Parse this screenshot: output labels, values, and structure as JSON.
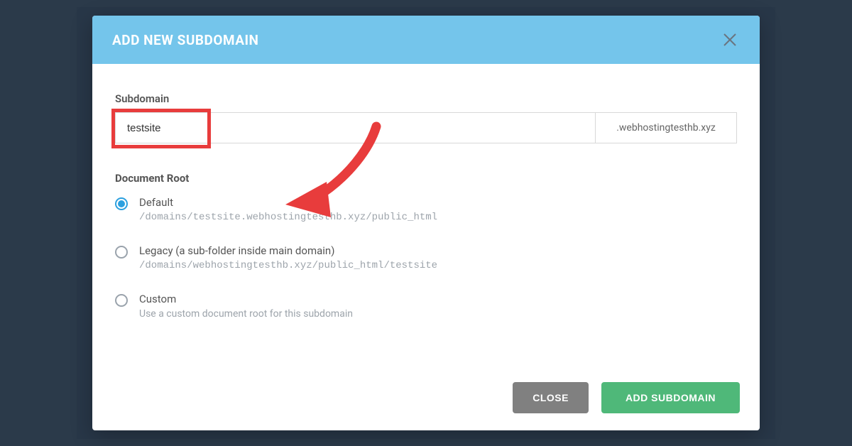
{
  "modal": {
    "title": "ADD NEW SUBDOMAIN",
    "subdomain_label": "Subdomain",
    "subdomain_value": "testsite",
    "domain_suffix": ".webhostingtesthb.xyz",
    "docroot_label": "Document Root",
    "options": {
      "default": {
        "title": "Default",
        "path": "/domains/testsite.webhostingtesthb.xyz/public_html"
      },
      "legacy": {
        "title": "Legacy (a sub-folder inside main domain)",
        "path": "/domains/webhostingtesthb.xyz/public_html/testsite"
      },
      "custom": {
        "title": "Custom",
        "desc": "Use a custom document root for this subdomain"
      }
    },
    "buttons": {
      "close": "CLOSE",
      "add": "ADD SUBDOMAIN"
    }
  }
}
